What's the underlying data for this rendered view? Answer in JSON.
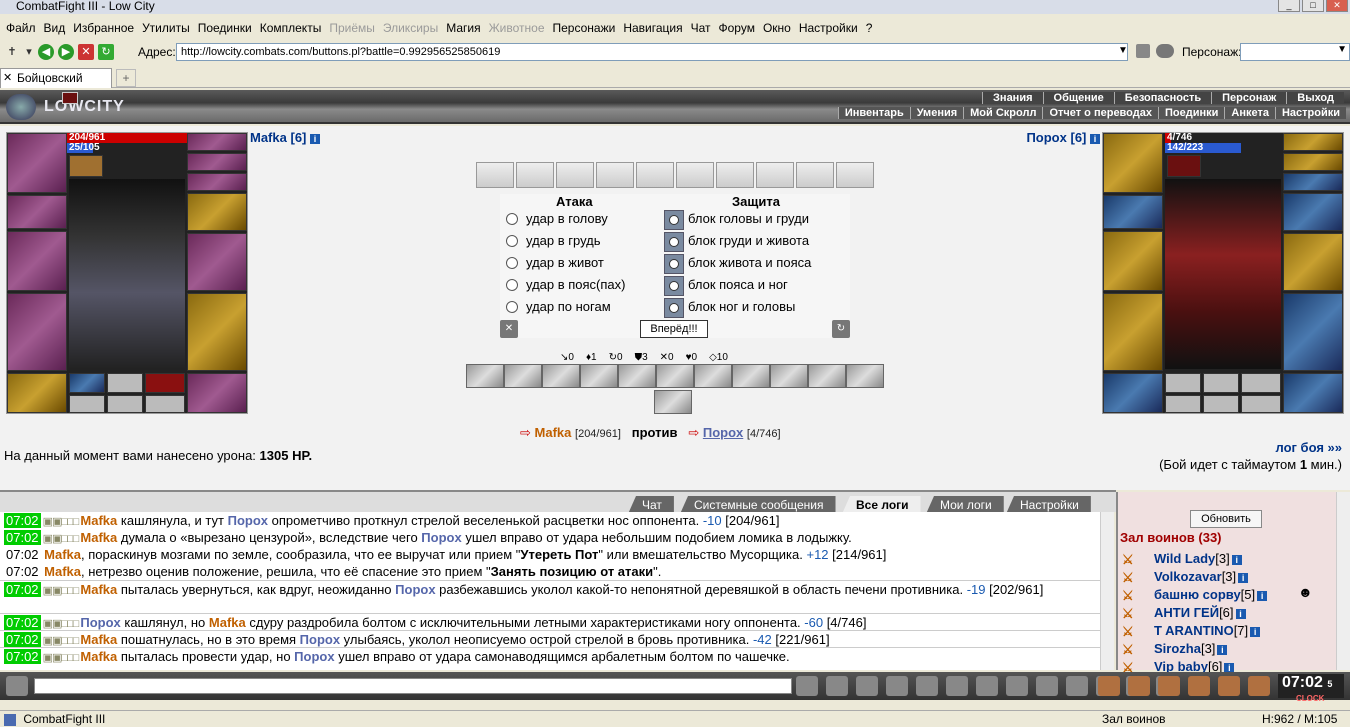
{
  "window": {
    "title": "CombatFight III - Low City"
  },
  "menu": [
    "Файл",
    "Вид",
    "Избранное",
    "Утилиты",
    "Поединки",
    "Комплекты",
    "Приёмы",
    "Эликсиры",
    "Магия",
    "Животное",
    "Персонажи",
    "Навигация",
    "Чат",
    "Форум",
    "Окно",
    "Настройки",
    "?"
  ],
  "menu_disabled": [
    "Приёмы",
    "Эликсиры",
    "Животное"
  ],
  "toolbar": {
    "address_label": "Адрес:",
    "address": "http://lowcity.combats.com/buttons.pl?battle=0.992956525850619",
    "persona_label": "Персонаж:"
  },
  "tab": {
    "label": "Бойцовский клуб",
    "new": "+"
  },
  "header": {
    "logo": "LOWCITY",
    "nav_top": [
      "Знания",
      "Общение",
      "Безопасность",
      "Персонаж",
      "Выход"
    ],
    "nav_bottom": [
      "Инвентарь",
      "Умения",
      "Мой Скролл",
      "Отчет о переводах",
      "Поединки",
      "Анкета",
      "Настройки"
    ]
  },
  "player": {
    "name": "Mafka",
    "level": "[6]",
    "hp": "204/961",
    "mana": "25/105"
  },
  "opponent": {
    "name": "Пороx",
    "level": "[6]",
    "hp": "4/746",
    "mana": "142/223"
  },
  "combat": {
    "attack_title": "Атака",
    "defense_title": "Защита",
    "attacks": [
      "удар в голову",
      "удар в грудь",
      "удар в живот",
      "удар в пояс(пах)",
      "удар по ногам"
    ],
    "blocks": [
      "блок головы и груди",
      "блок груди и живота",
      "блок живота и пояса",
      "блок пояса и ног",
      "блок ног и головы"
    ],
    "forward": "Вперёд!!!"
  },
  "stats": [
    "↘0",
    "♦1",
    "↻0",
    "⛊3",
    "✕0",
    "♥0",
    "◇10"
  ],
  "versus": {
    "p1": "Mafka",
    "p1_hp": "[204/961]",
    "vs": "против",
    "p2": "Пороx",
    "p2_hp": "[4/746]"
  },
  "damage": {
    "text": "На данный момент вами нанесено урона:",
    "value": "1305 HP."
  },
  "battle_log_link": "лог боя »»",
  "timeout": {
    "pre": "(Бой идет с таймаутом",
    "value": "1",
    "post": "мин.)"
  },
  "chat_tabs": [
    "Чат",
    "Системные сообщения",
    "Все логи",
    "Мои логи",
    "Настройки"
  ],
  "chat_active": "Все логи",
  "log": [
    {
      "time": "07:02",
      "pre": "",
      "m": "Mafka",
      "t1": " кашлянула, и тут ",
      "p": "Пороx",
      "t2": " опрометчиво проткнул стрелой веселенькой расцветки нос оппонента. ",
      "dmg": "-10",
      "hp": " [204/961]"
    },
    {
      "time": "07:02",
      "pre": "",
      "m": "Mafka",
      "t1": " думала о «вырезано цензурой», вследствие чего ",
      "p": "Пороx",
      "t2": " ушел вправо от удара небольшим подобием ломика в лодыжку.",
      "dmg": "",
      "hp": ""
    },
    {
      "time": "07:02",
      "pre": "",
      "m": "Mafka",
      "t1": ", пораскинув мозгами по земле, сообразила, что ее выручат или прием \"",
      "b": "Утереть Пот",
      "t2": "\" или вмешательство Мусорщика. ",
      "dmg": "+12",
      "hp": " [214/961]"
    },
    {
      "time": "07:02",
      "pre": "",
      "m": "Mafka",
      "t1": ", нетрезво оценив положение, решила, что её спасение это прием \"",
      "b": "Занять позицию от атаки",
      "t2": "\".",
      "dmg": "",
      "hp": ""
    },
    {
      "time": "07:02",
      "pre": "",
      "m": "Mafka",
      "t1": " пыталась увернуться, как вдруг, неожиданно ",
      "p": "Пороx",
      "t2": " разбежавшись уколол какой-то непонятной деревяшкой в область печени противника. ",
      "dmg": "-19",
      "hp": " [202/961]"
    },
    {
      "time": "07:02",
      "pre": "",
      "m": "Пороx",
      "t1": " кашлянул, но ",
      "p": "Mafka",
      "t2": " сдуру раздробила болтом с исключительными летными характеристиками ногу оппонента. ",
      "dmg": "-60",
      "hp": " [4/746]"
    },
    {
      "time": "07:02",
      "pre": "",
      "m": "Mafka",
      "t1": " пошатнулась, но в это время ",
      "p": "Пороx",
      "t2": " улыбаясь, уколол неописуемо острой стрелой в бровь противника. ",
      "dmg": "-42",
      "hp": " [221/961]"
    },
    {
      "time": "07:02",
      "pre": "",
      "m": "Mafka",
      "t1": " пыталась провести удар, но ",
      "p": "Пороx",
      "t2": " ушел вправо от удара самонаводящимся арбалетным болтом по чашечке.",
      "dmg": "",
      "hp": ""
    }
  ],
  "sidebar": {
    "refresh": "Обновить",
    "hall": "Зал воинов (33)",
    "warriors": [
      {
        "name": "Wild Lady",
        "lvl": "[3]"
      },
      {
        "name": "Volkozavar",
        "lvl": "[3]"
      },
      {
        "name": "башню сорву",
        "lvl": "[5]"
      },
      {
        "name": "АНТИ ГЕЙ",
        "lvl": "[6]"
      },
      {
        "name": "T ARANTINO",
        "lvl": "[7]"
      },
      {
        "name": "Sirozha",
        "lvl": "[3]"
      },
      {
        "name": "Vip baby",
        "lvl": "[6]"
      }
    ]
  },
  "clock": {
    "time": "07:02",
    "sec": "5",
    "sub": "CLOCK TIMER"
  },
  "status": {
    "app": "CombatFight III",
    "room": "Зал воинов",
    "hm": "H:962 / M:105"
  }
}
